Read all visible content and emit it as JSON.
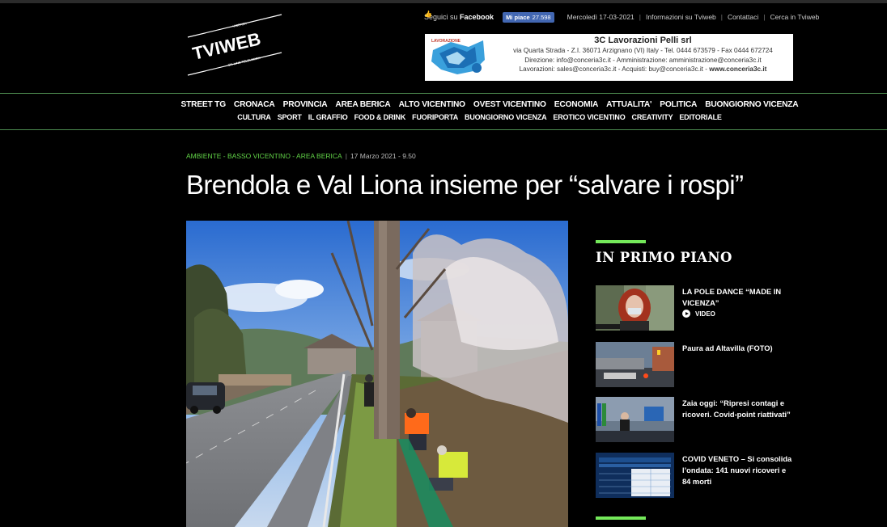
{
  "site": {
    "logo_text": "TVIWEB",
    "logo_top": "VICENZA",
    "logo_bottom": "ON-LINE TELEVISION"
  },
  "topbar": {
    "follow_prefix": "Seguici su",
    "follow_network": "Facebook",
    "like_label": "Mi piace",
    "like_count": "27.598",
    "date": "Mercoledì 17-03-2021",
    "links": [
      "Informazioni su Tviweb",
      "Contattaci",
      "Cerca in Tviweb"
    ]
  },
  "banner": {
    "title": "3C Lavorazioni Pelli srl",
    "line1": "via Quarta Strada - Z.I. 36071 Arzignano (VI) Italy - Tel. 0444 673579 - Fax 0444 672724",
    "line2": "Direzione: info@conceria3c.it - Amministrazione: amministrazione@conceria3c.it",
    "line3_a": "Lavorazioni: sales@conceria3c.it - Acquisti: buy@conceria3c.it - ",
    "line3_b": "www.conceria3c.it"
  },
  "nav": {
    "primary": [
      "STREET TG",
      "CRONACA",
      "PROVINCIA",
      "AREA BERICA",
      "ALTO VICENTINO",
      "OVEST VICENTINO",
      "ECONOMIA",
      "ATTUALITA'",
      "POLITICA",
      "BUONGIORNO VICENZA"
    ],
    "secondary": [
      "CULTURA",
      "SPORT",
      "IL GRAFFIO",
      "FOOD & DRINK",
      "FUORIPORTA",
      "BUONGIORNO VICENZA",
      "EROTICO VICENTINO",
      "CREATIVITY",
      "EDITORIALE"
    ]
  },
  "article": {
    "categories": "AMBIENTE - BASSO VICENTINO - AREA BERICA",
    "date": "17 Marzo 2021 - 9.50",
    "title": "Brendola e Val Liona insieme per “salvare i rospi”"
  },
  "sidebar": {
    "title": "IN PRIMO PIANO",
    "items": [
      {
        "title": "LA POLE DANCE “MADE IN VICENZA”",
        "badge": "VIDEO"
      },
      {
        "title": "Paura ad Altavilla (FOTO)"
      },
      {
        "title": "Zaia oggi: “Ripresi contagi e ricoveri. Covid-point riattivati”"
      },
      {
        "title": "COVID VENETO – Si consolida l’ondata: 141 nuovi ricoveri e 84 morti"
      }
    ]
  },
  "colors": {
    "accent_green": "#74e85a",
    "category_green": "#62d448",
    "facebook_blue": "#4267b2",
    "background": "#000000"
  }
}
